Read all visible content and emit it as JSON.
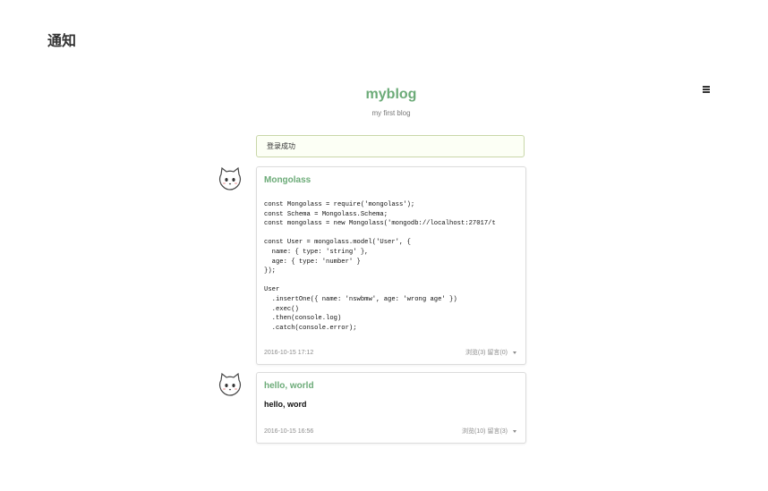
{
  "notice": {
    "title": "通知"
  },
  "header": {
    "blog_title": "myblog",
    "blog_subtitle": "my first blog",
    "menu_icon": "hamburger-menu-icon"
  },
  "alert": {
    "message": "登录成功"
  },
  "posts": [
    {
      "title": "Mongolass",
      "code": "const Mongolass = require('mongolass');\nconst Schema = Mongolass.Schema;\nconst mongolass = new Mongolass('mongodb://localhost:27017/t\n\nconst User = mongolass.model('User', {\n  name: { type: 'string' },\n  age: { type: 'number' }\n});\n\nUser\n  .insertOne({ name: 'nswbmw', age: 'wrong age' })\n  .exec()\n  .then(console.log)\n  .catch(console.error);",
      "date": "2016-10-15 17:12",
      "stats": "浏览(3) 留言(0)",
      "avatar_icon": "cat-avatar-icon"
    },
    {
      "title": "hello, world",
      "content": "hello, word",
      "date": "2016-10-15 16:56",
      "stats": "浏览(10) 留言(3)",
      "avatar_icon": "cat-avatar-icon"
    }
  ],
  "colors": {
    "accent": "#6cab78",
    "alert_border": "#c9d7a9",
    "alert_background": "#fcfff5",
    "card_border": "#dcdcdc",
    "meta_text": "#8c8c8c"
  }
}
